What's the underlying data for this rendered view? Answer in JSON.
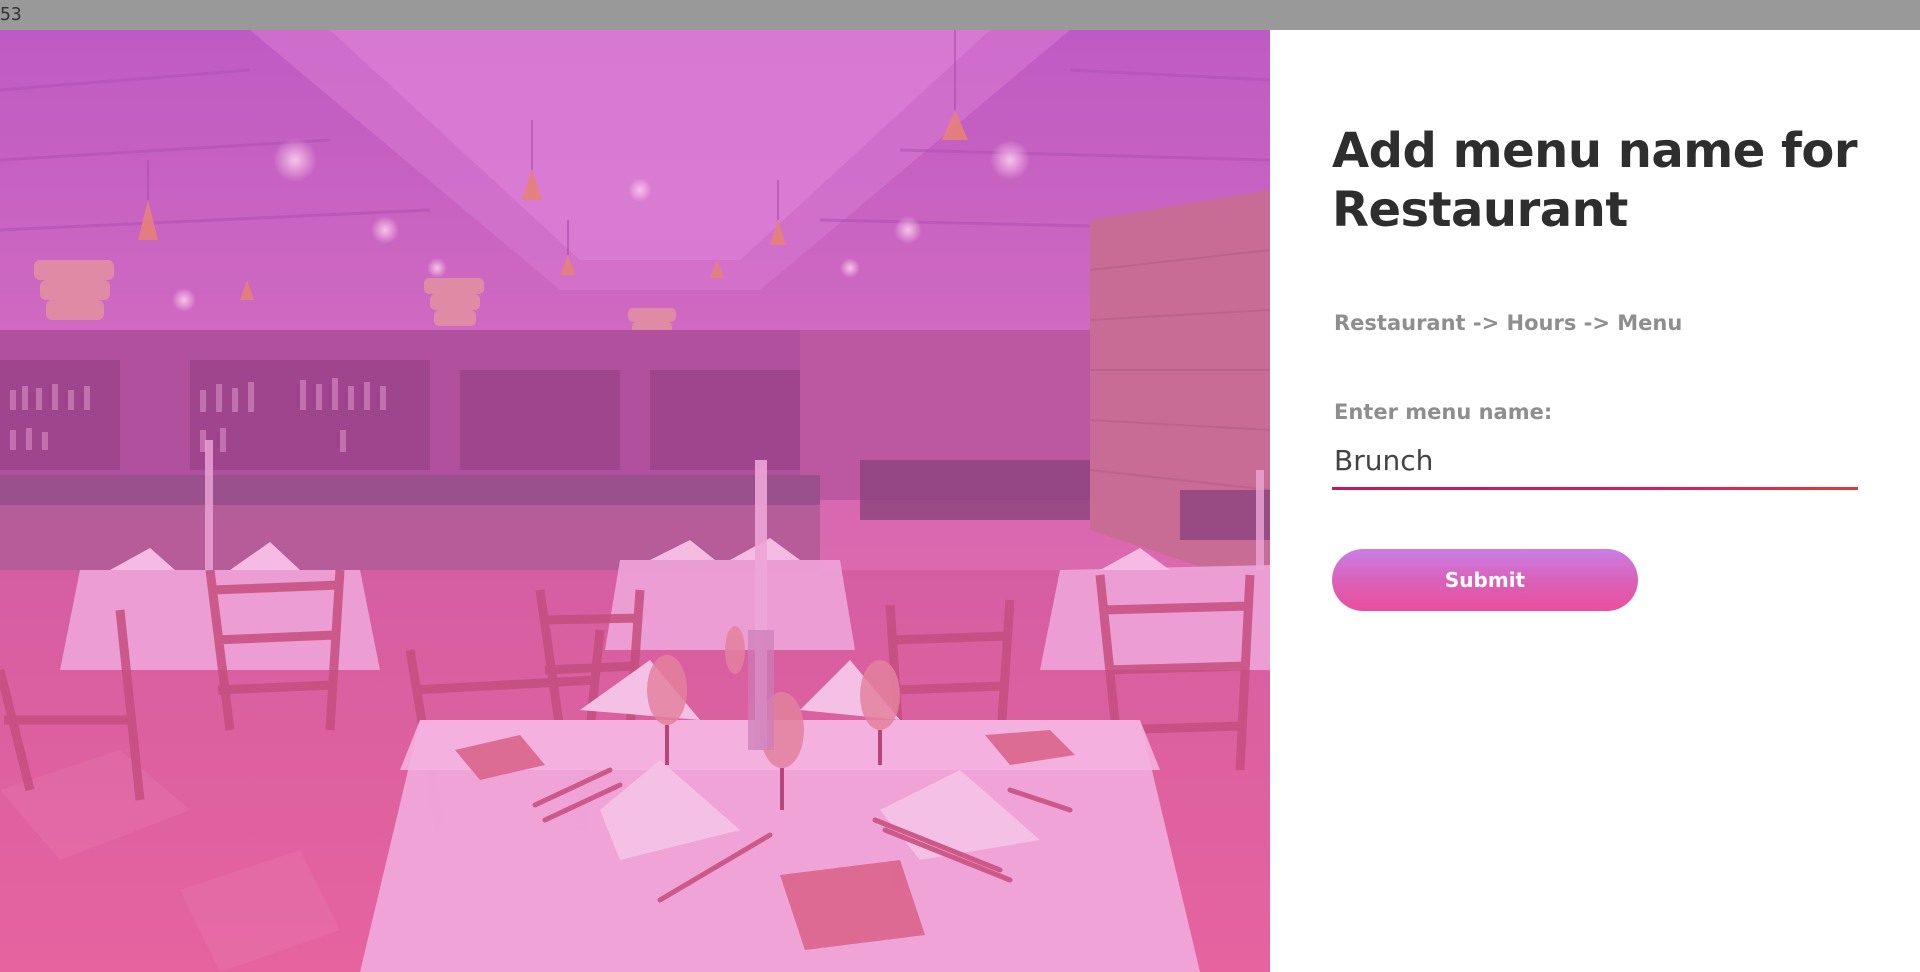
{
  "top_bar": {
    "text": "53"
  },
  "hero": {
    "image": "restaurant-dining-room-photo",
    "tint": "#d86ac0"
  },
  "panel": {
    "title": "Add menu name for Restaurant",
    "breadcrumb": "Restaurant -> Hours -> Menu",
    "field": {
      "label": "Enter menu name:",
      "value": "Brunch"
    },
    "submit_label": "Submit"
  },
  "colors": {
    "accent_gradient_start": "#c97ee6",
    "accent_gradient_end": "#ea4f9c",
    "underline": "#d81b60",
    "title_text": "#2e2e2e",
    "muted_text": "#8e8e8e"
  }
}
